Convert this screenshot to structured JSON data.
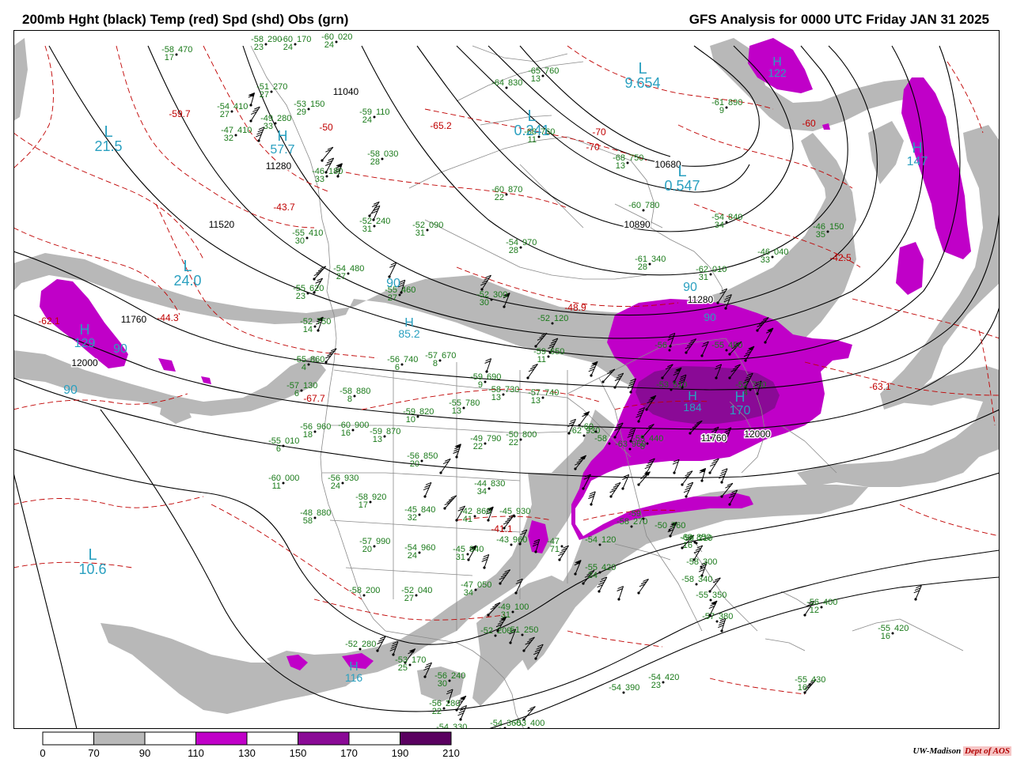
{
  "header": {
    "left_title": "200mb Hght (black) Temp (red) Spd (shd) Obs (grn)",
    "right_title": "GFS Analysis for 0000 UTC Friday  JAN 31 2025"
  },
  "colorbar": {
    "labels": [
      "0",
      "70",
      "90",
      "110",
      "130",
      "150",
      "170",
      "190",
      "210"
    ],
    "bins": [
      {
        "from": 0,
        "to": 70,
        "color": "#ffffff"
      },
      {
        "from": 70,
        "to": 90,
        "color": "#b8b8b8"
      },
      {
        "from": 90,
        "to": 110,
        "color": "#ffffff"
      },
      {
        "from": 110,
        "to": 130,
        "color": "#c000c8"
      },
      {
        "from": 130,
        "to": 150,
        "color": "#ffffff"
      },
      {
        "from": 150,
        "to": 170,
        "color": "#8a0a96"
      },
      {
        "from": 170,
        "to": 190,
        "color": "#ffffff"
      },
      {
        "from": 190,
        "to": 210,
        "color": "#5a0060"
      }
    ]
  },
  "colors": {
    "height": "#000000",
    "temperature": "#c00000",
    "speed_gray": "#b8b8b8",
    "speed_magenta": "#c000c8",
    "speed_purple": "#8a0a96",
    "obs": "#1a7a1a",
    "maxmin": "#2aa0c0",
    "map_lines": "#8a8a8a"
  },
  "height_labels": [
    "11040",
    "11280",
    "11520",
    "11760",
    "10680",
    "10890",
    "11280",
    "12000",
    "12000",
    "11760"
  ],
  "temp_labels": [
    "-59.7",
    "-43.7",
    "-44.3",
    "-48.9",
    "-62.1",
    "-67.7",
    "-63.1",
    "-42.5",
    "-65.2",
    "-50",
    "-60",
    "-70",
    "-41.1",
    "-70"
  ],
  "center_markers": [
    {
      "letter": "L",
      "value": "21.5",
      "color": "cyan"
    },
    {
      "letter": "H",
      "value": "57.7",
      "color": "cyan"
    },
    {
      "letter": "L",
      "value": "24.0",
      "color": "cyan"
    },
    {
      "letter": "H",
      "value": "129",
      "color": "cyan"
    },
    {
      "letter": "L",
      "value": "10.6",
      "color": "cyan"
    },
    {
      "letter": "H",
      "value": "85.2",
      "color": "cyan"
    },
    {
      "letter": "L",
      "value": "0.241",
      "color": "cyan"
    },
    {
      "letter": "L",
      "value": "9.654",
      "color": "cyan"
    },
    {
      "letter": "L",
      "value": "0.547",
      "color": "cyan"
    },
    {
      "letter": "H",
      "value": "122",
      "color": "cyan"
    },
    {
      "letter": "H",
      "value": "147",
      "color": "cyan"
    },
    {
      "letter": "H",
      "value": "184",
      "color": "cyan"
    },
    {
      "letter": "H",
      "value": "170",
      "color": "cyan"
    },
    {
      "letter": "H",
      "value": "116",
      "color": "cyan"
    },
    {
      "letter": "",
      "value": "90",
      "color": "cyan"
    },
    {
      "letter": "",
      "value": "90",
      "color": "cyan"
    },
    {
      "letter": "",
      "value": "90",
      "color": "cyan"
    },
    {
      "letter": "",
      "value": "90",
      "color": "cyan"
    },
    {
      "letter": "",
      "value": "90",
      "color": "cyan"
    }
  ],
  "observations": [
    {
      "temp": "-58",
      "hgt": "470",
      "dew": "17"
    },
    {
      "temp": "-58",
      "hgt": "290",
      "dew": "23"
    },
    {
      "temp": "-60",
      "hgt": "170",
      "dew": "24"
    },
    {
      "temp": "-60",
      "hgt": "020",
      "dew": "24"
    },
    {
      "temp": "-51",
      "hgt": "270",
      "dew": "27"
    },
    {
      "temp": "-53",
      "hgt": "150",
      "dew": "29"
    },
    {
      "temp": "-54",
      "hgt": "410",
      "dew": "27"
    },
    {
      "temp": "-49",
      "hgt": "280",
      "dew": "33"
    },
    {
      "temp": "-47",
      "hgt": "410",
      "dew": "32"
    },
    {
      "temp": "-59",
      "hgt": "110",
      "dew": "24"
    },
    {
      "temp": "-64",
      "hgt": "830",
      "dew": ""
    },
    {
      "temp": "-65",
      "hgt": "760",
      "dew": "13"
    },
    {
      "temp": "-61",
      "hgt": "890",
      "dew": "9"
    },
    {
      "temp": "-58",
      "hgt": "030",
      "dew": "28"
    },
    {
      "temp": "-68",
      "hgt": "760",
      "dew": "11"
    },
    {
      "temp": "-68",
      "hgt": "750",
      "dew": "13"
    },
    {
      "temp": "-46",
      "hgt": "180",
      "dew": "33"
    },
    {
      "temp": "-60",
      "hgt": "870",
      "dew": "22"
    },
    {
      "temp": "-60",
      "hgt": "780",
      "dew": ""
    },
    {
      "temp": "-54",
      "hgt": "840",
      "dew": "34"
    },
    {
      "temp": "-46",
      "hgt": "150",
      "dew": "35"
    },
    {
      "temp": "-46",
      "hgt": "040",
      "dew": "33"
    },
    {
      "temp": "-52",
      "hgt": "240",
      "dew": "31"
    },
    {
      "temp": "-52",
      "hgt": "090",
      "dew": "31"
    },
    {
      "temp": "-54",
      "hgt": "970",
      "dew": "28"
    },
    {
      "temp": "-55",
      "hgt": "410",
      "dew": "30"
    },
    {
      "temp": "-61",
      "hgt": "340",
      "dew": "28"
    },
    {
      "temp": "-62",
      "hgt": "010",
      "dew": "31"
    },
    {
      "temp": "-54",
      "hgt": "480",
      "dew": "27"
    },
    {
      "temp": "-55",
      "hgt": "460",
      "dew": "27"
    },
    {
      "temp": "-52",
      "hgt": "300",
      "dew": "30"
    },
    {
      "temp": "-52",
      "hgt": "120",
      "dew": ""
    },
    {
      "temp": "-55",
      "hgt": "620",
      "dew": "23"
    },
    {
      "temp": "-52",
      "hgt": "750",
      "dew": "14"
    },
    {
      "temp": "-55",
      "hgt": "860",
      "dew": "4"
    },
    {
      "temp": "-56",
      "hgt": "740",
      "dew": "6"
    },
    {
      "temp": "-57",
      "hgt": "670",
      "dew": "8"
    },
    {
      "temp": "-59",
      "hgt": "650",
      "dew": "11"
    },
    {
      "temp": "-59",
      "hgt": "690",
      "dew": "9"
    },
    {
      "temp": "-57",
      "hgt": "130",
      "dew": "6"
    },
    {
      "temp": "-58",
      "hgt": "880",
      "dew": "8"
    },
    {
      "temp": "-58",
      "hgt": "730",
      "dew": "13"
    },
    {
      "temp": "-57",
      "hgt": "740",
      "dew": "13"
    },
    {
      "temp": "-55",
      "hgt": "780",
      "dew": "13"
    },
    {
      "temp": "-59",
      "hgt": "820",
      "dew": "10"
    },
    {
      "temp": "-56",
      "hgt": "960",
      "dew": "18"
    },
    {
      "temp": "-60",
      "hgt": "900",
      "dew": "16"
    },
    {
      "temp": "-59",
      "hgt": "870",
      "dew": "13"
    },
    {
      "temp": "-49",
      "hgt": "790",
      "dew": "22"
    },
    {
      "temp": "-50",
      "hgt": "800",
      "dew": "22"
    },
    {
      "temp": "-56",
      "hgt": "850",
      "dew": "20"
    },
    {
      "temp": "-55",
      "hgt": "010",
      "dew": "6"
    },
    {
      "temp": "-60",
      "hgt": "000",
      "dew": "11"
    },
    {
      "temp": "-56",
      "hgt": "930",
      "dew": "24"
    },
    {
      "temp": "-58",
      "hgt": "920",
      "dew": "17"
    },
    {
      "temp": "-44",
      "hgt": "830",
      "dew": "34"
    },
    {
      "temp": "-45",
      "hgt": "840",
      "dew": "32"
    },
    {
      "temp": "-42",
      "hgt": "860",
      "dew": "41"
    },
    {
      "temp": "-45",
      "hgt": "930",
      "dew": ""
    },
    {
      "temp": "-48",
      "hgt": "880",
      "dew": "58"
    },
    {
      "temp": "-57",
      "hgt": "990",
      "dew": "20"
    },
    {
      "temp": "-54",
      "hgt": "960",
      "dew": "24"
    },
    {
      "temp": "-45",
      "hgt": "940",
      "dew": "31"
    },
    {
      "temp": "-43",
      "hgt": "960",
      "dew": ""
    },
    {
      "temp": "-47",
      "hgt": "",
      "dew": "71"
    },
    {
      "temp": "-54",
      "hgt": "120",
      "dew": ""
    },
    {
      "temp": "-58",
      "hgt": "200",
      "dew": ""
    },
    {
      "temp": "-52",
      "hgt": "040",
      "dew": "27"
    },
    {
      "temp": "-47",
      "hgt": "050",
      "dew": "34"
    },
    {
      "temp": "-49",
      "hgt": "100",
      "dew": "31"
    },
    {
      "temp": "-52",
      "hgt": "200",
      "dew": ""
    },
    {
      "temp": "-51",
      "hgt": "250",
      "dew": ""
    },
    {
      "temp": "-52",
      "hgt": "280",
      "dew": ""
    },
    {
      "temp": "-53",
      "hgt": "170",
      "dew": "25"
    },
    {
      "temp": "-56",
      "hgt": "240",
      "dew": "30"
    },
    {
      "temp": "-56",
      "hgt": "280",
      "dew": "22"
    },
    {
      "temp": "-54",
      "hgt": "330",
      "dew": "12"
    },
    {
      "temp": "-54",
      "hgt": "360",
      "dew": "12"
    },
    {
      "temp": "-53",
      "hgt": "400",
      "dew": ""
    },
    {
      "temp": "-54",
      "hgt": "390",
      "dew": ""
    },
    {
      "temp": "-54",
      "hgt": "420",
      "dew": "23"
    },
    {
      "temp": "-55",
      "hgt": "420",
      "dew": "24"
    },
    {
      "temp": "-58",
      "hgt": "270",
      "dew": ""
    },
    {
      "temp": "-59",
      "hgt": "",
      "dew": ""
    },
    {
      "temp": "-59",
      "hgt": "210",
      "dew": ""
    },
    {
      "temp": "-58",
      "hgt": "300",
      "dew": ""
    },
    {
      "temp": "-58",
      "hgt": "340",
      "dew": ""
    },
    {
      "temp": "-55",
      "hgt": "350",
      "dew": ""
    },
    {
      "temp": "-57",
      "hgt": "380",
      "dew": ""
    },
    {
      "temp": "-56",
      "hgt": "400",
      "dew": "12"
    },
    {
      "temp": "-55",
      "hgt": "420",
      "dew": "16"
    },
    {
      "temp": "-55",
      "hgt": "430",
      "dew": "16"
    },
    {
      "temp": "-55",
      "hgt": "440",
      "dew": "8"
    },
    {
      "temp": "-63",
      "hgt": "960",
      "dew": ""
    },
    {
      "temp": "-62",
      "hgt": "930",
      "dew": ""
    },
    {
      "temp": "-60",
      "hgt": "",
      "dew": ""
    },
    {
      "temp": "-58",
      "hgt": "",
      "dew": ""
    },
    {
      "temp": "-56",
      "hgt": "",
      "dew": ""
    },
    {
      "temp": "-55",
      "hgt": "450",
      "dew": ""
    },
    {
      "temp": "-53",
      "hgt": "510",
      "dew": ""
    },
    {
      "temp": "-52",
      "hgt": "730",
      "dew": "4"
    },
    {
      "temp": "-50",
      "hgt": "760",
      "dew": ""
    },
    {
      "temp": "-60",
      "hgt": "850",
      "dew": "16"
    },
    {
      "temp": "-59",
      "hgt": "880",
      "dew": "14"
    }
  ],
  "footer": {
    "credit": "UW-Madison",
    "dept": "Dept of AOS"
  }
}
